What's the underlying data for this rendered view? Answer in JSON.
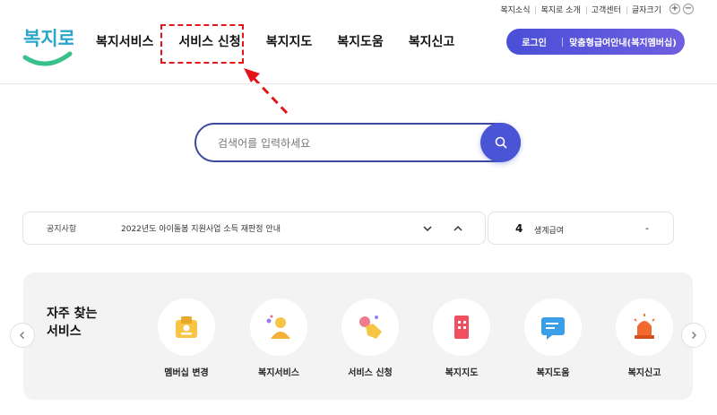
{
  "utility_links": [
    "복지소식",
    "복지로 소개",
    "고객센터"
  ],
  "font_size": {
    "label": "글자크기",
    "increase": "+",
    "decrease": "−"
  },
  "logo": {
    "text": "복지로",
    "color": "#2aa6c9"
  },
  "nav": [
    "복지서비스",
    "서비스 신청",
    "복지지도",
    "복지도움",
    "복지신고"
  ],
  "login": {
    "login_label": "로그인",
    "custom_label": "맞춤형급여안내(복지멤버십)"
  },
  "search": {
    "placeholder": "검색어를 입력하세요",
    "icon": "search-icon"
  },
  "notice": {
    "label": "공지사항",
    "text": "2022년도 아이돌봄 지원사업 소득 재판정 안내"
  },
  "ranking": {
    "number": "4",
    "name": "생계급여",
    "trend": "-"
  },
  "frequent": {
    "title_line1": "자주 찾는",
    "title_line2": "서비스",
    "items": [
      {
        "label": "멤버십 변경",
        "icon": "membership-icon"
      },
      {
        "label": "복지서비스",
        "icon": "person-icon"
      },
      {
        "label": "서비스 신청",
        "icon": "hand-tap-icon"
      },
      {
        "label": "복지지도",
        "icon": "map-building-icon"
      },
      {
        "label": "복지도움",
        "icon": "chat-icon"
      },
      {
        "label": "복지신고",
        "icon": "siren-icon"
      }
    ]
  },
  "colors": {
    "primary": "#4a55d6",
    "annotation": "#e4141b",
    "panel": "#f3f3f3"
  }
}
